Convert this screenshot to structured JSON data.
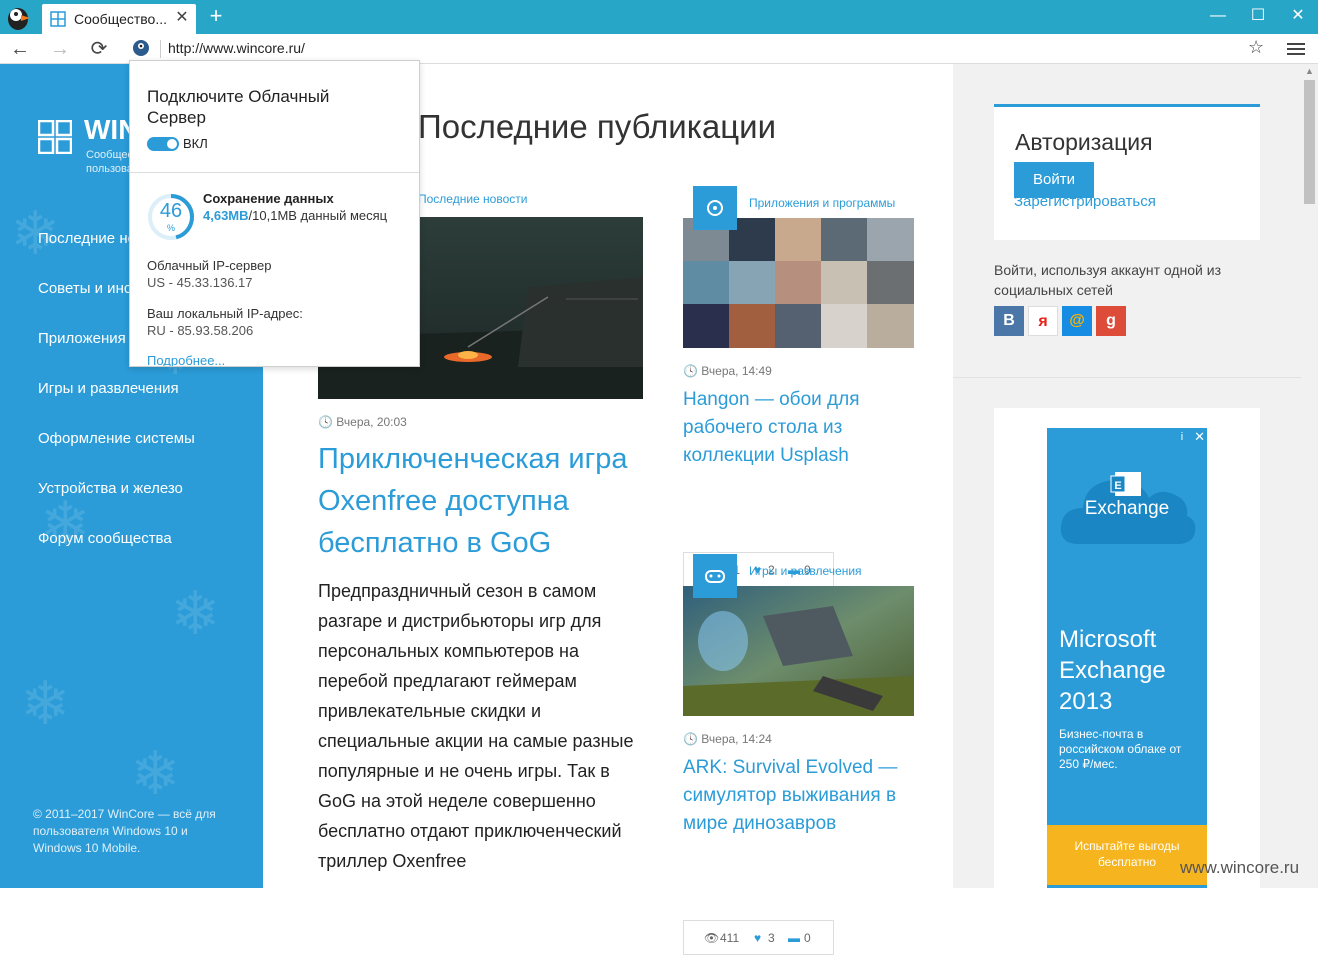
{
  "colors": {
    "accent": "#2b9cd8",
    "titlebar": "#28a6c8",
    "ad_cta": "#f6b51e"
  },
  "browser": {
    "tab_title": "Сообщество...",
    "tab_close": "✕",
    "new_tab": "+",
    "minimize": "—",
    "maximize": "☐",
    "close": "✕",
    "back": "←",
    "forward": "→",
    "reload": "⟳",
    "url": "http://www.wincore.ru/",
    "star": "☆"
  },
  "sidebar": {
    "brand": "WINCORE",
    "brand_sub": "Сообщество пользователей",
    "items": [
      {
        "label": "Последние новости"
      },
      {
        "label": "Советы и инструкции"
      },
      {
        "label": "Приложения и программы"
      },
      {
        "label": "Игры и развлечения"
      },
      {
        "label": "Оформление системы"
      },
      {
        "label": "Устройства и железо"
      },
      {
        "label": "Форум сообщества"
      }
    ],
    "copyright": "© 2011–2017 WinCore — всё для пользователя Windows 10 и Windows 10 Mobile."
  },
  "main": {
    "title": "Последние публикации",
    "featured": {
      "category": "Последние новости",
      "date": "Вчера, 20:03",
      "title": "Приключенческая игра Oxenfree доступна бесплатно в GoG",
      "text": "Предпраздничный сезон в самом разгаре и дистрибьюторы игр для персональных компьютеров на перебой предлагают геймерам привлекательные скидки и специальные акции на самые разные популярные и не очень игры. Так в GoG на этой неделе совершенно бесплатно отдают приключенческий триллер Oxenfree"
    },
    "cards": [
      {
        "category": "Приложения и программы",
        "date": "Вчера, 14:49",
        "title": "Hangon — обои для рабочего стола из коллекции Usplash",
        "views": "281",
        "likes": "2",
        "comments": "0"
      },
      {
        "category": "Игры и развлечения",
        "date": "Вчера, 14:24",
        "title": "ARK: Survival Evolved — симулятор выживания в мире динозавров",
        "views": "411",
        "likes": "3",
        "comments": "0"
      }
    ]
  },
  "auth": {
    "title": "Авторизация",
    "login": "Войти",
    "register": "Зарегистрироваться",
    "social_text": "Войти, используя аккаунт одной из социальных сетей",
    "social": [
      {
        "label": "B",
        "color": "#4a76a8"
      },
      {
        "label": "я",
        "color": "#ffffff"
      },
      {
        "label": "@",
        "color": "#168de2"
      },
      {
        "label": "g",
        "color": "#dd4b39"
      }
    ]
  },
  "ad": {
    "info": "i",
    "close": "✕",
    "product_label": "Exchange",
    "heading": "Microsoft Exchange 2013",
    "text": "Бизнес-почта в российском облаке от 250 ₽/мес.",
    "cta": "Испытайте выгоды бесплатно"
  },
  "popup": {
    "title": "Подключите Облачный Сервер",
    "toggle_label": "ВКЛ",
    "percent": "46",
    "percent_sign": "%",
    "percent_value": 0.46,
    "save_title": "Сохранение данных",
    "saved": "4,63MB",
    "total": "/10,1MB данный месяц",
    "ip_label": "Облачный IP-сервер",
    "ip_value": "US - 45.33.136.17",
    "local_label": "Ваш локальный IP-адрес:",
    "local_value": "RU - 85.93.58.206",
    "more": "Подробнее..."
  },
  "watermark": "www.wincore.ru"
}
